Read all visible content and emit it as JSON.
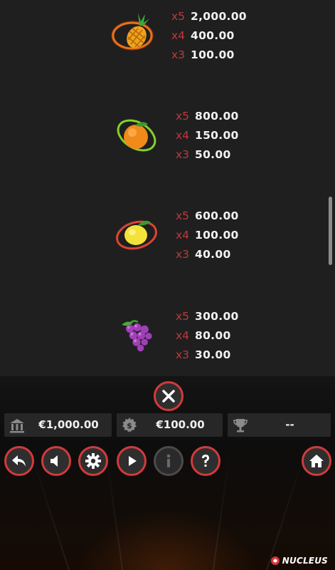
{
  "paytable": {
    "symbols": [
      {
        "name": "pineapple",
        "pays": [
          {
            "mult": "x5",
            "amount": "2,000.00"
          },
          {
            "mult": "x4",
            "amount": "400.00"
          },
          {
            "mult": "x3",
            "amount": "100.00"
          }
        ]
      },
      {
        "name": "orange",
        "pays": [
          {
            "mult": "x5",
            "amount": "800.00"
          },
          {
            "mult": "x4",
            "amount": "150.00"
          },
          {
            "mult": "x3",
            "amount": "50.00"
          }
        ]
      },
      {
        "name": "lemon",
        "pays": [
          {
            "mult": "x5",
            "amount": "600.00"
          },
          {
            "mult": "x4",
            "amount": "100.00"
          },
          {
            "mult": "x3",
            "amount": "40.00"
          }
        ]
      },
      {
        "name": "grapes",
        "pays": [
          {
            "mult": "x5",
            "amount": "300.00"
          },
          {
            "mult": "x4",
            "amount": "80.00"
          },
          {
            "mult": "x3",
            "amount": "30.00"
          }
        ]
      }
    ]
  },
  "info_bar": {
    "balance": "€1,000.00",
    "bet": "€100.00",
    "win": "--"
  },
  "buttons": [
    "close-icon",
    "back-icon",
    "sound-icon",
    "settings-icon",
    "autoplay-icon",
    "info-icon",
    "help-icon",
    "home-icon"
  ],
  "logo": {
    "text": "NUCLEUS"
  },
  "colors": {
    "accent": "#d23a3a",
    "multiplier": "#c0393b",
    "background": "#1f1f1f"
  }
}
